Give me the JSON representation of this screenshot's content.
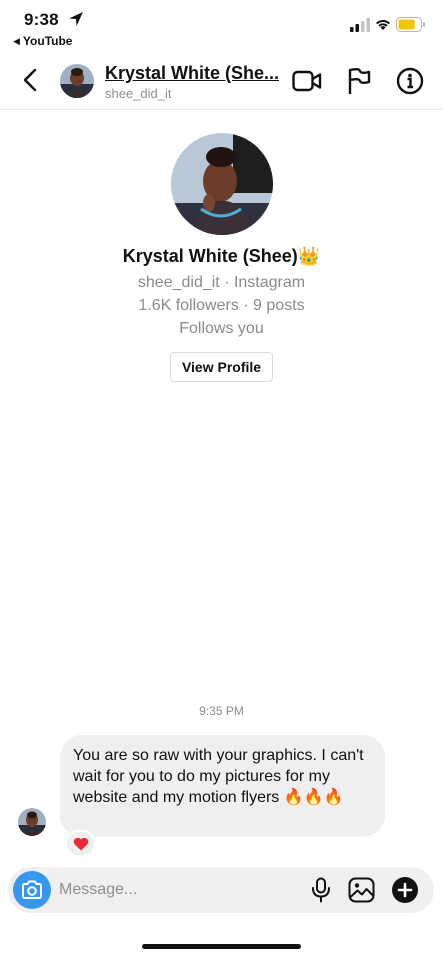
{
  "status_bar": {
    "time": "9:38",
    "back_app": "YouTube",
    "battery_color": "#f5c400"
  },
  "header": {
    "name": "Krystal White (She...",
    "username": "shee_did_it"
  },
  "profile": {
    "display_name": "Krystal White (Shee)",
    "crown_emoji": "👑",
    "handle_line": "shee_did_it · Instagram",
    "stats_line": "1.6K followers · 9 posts",
    "follows_line": "Follows you",
    "view_profile_label": "View Profile"
  },
  "chat": {
    "timestamp": "9:35 PM",
    "messages": [
      {
        "text": "You are so raw with your graphics. I can't wait for you to do my pictures for my website and my motion flyers 🔥🔥🔥",
        "reaction": "❤️"
      }
    ]
  },
  "composer": {
    "placeholder": "Message..."
  },
  "colors": {
    "accent_blue": "#3797f0",
    "bubble_gray": "#efefef",
    "heart_red": "#ed2939"
  },
  "icons": {
    "header": [
      "back-arrow-icon",
      "video-icon",
      "flag-icon",
      "info-icon"
    ],
    "composer": [
      "camera-icon",
      "microphone-icon",
      "gallery-icon",
      "plus-icon"
    ]
  }
}
